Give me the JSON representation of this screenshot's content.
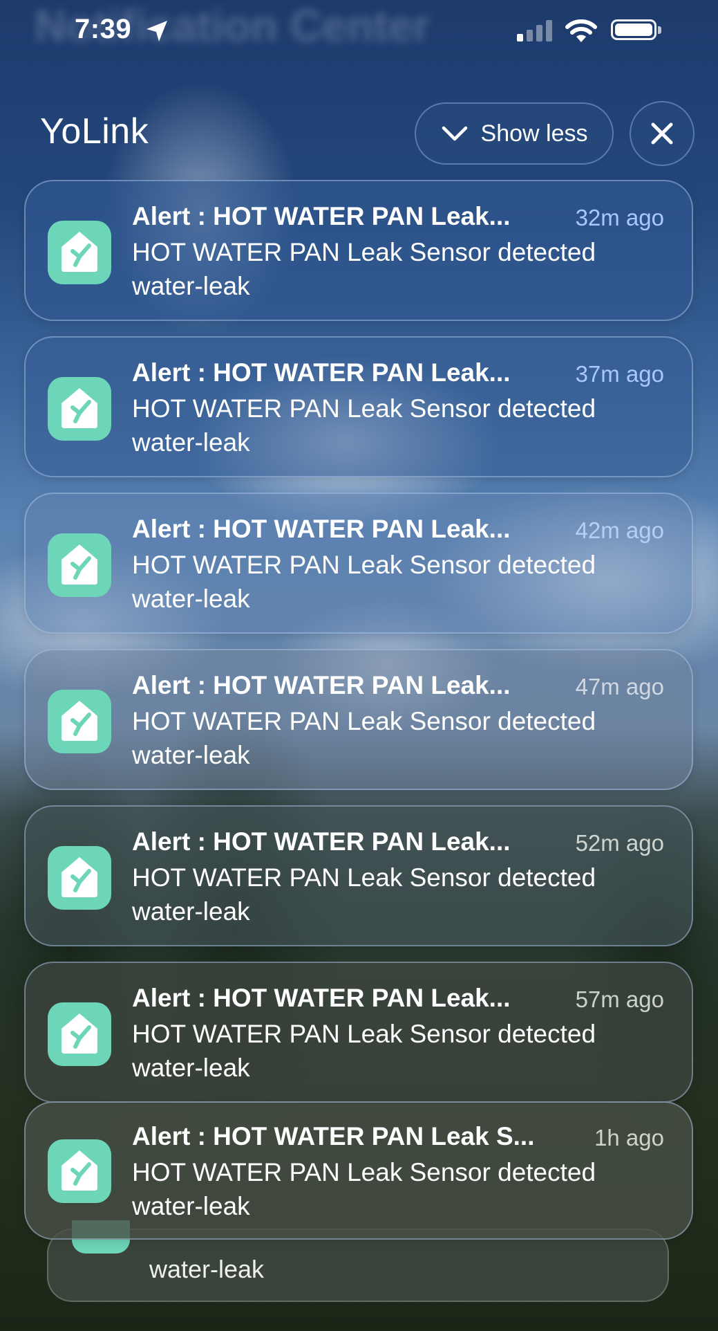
{
  "status_bar": {
    "background_title": "Notification Center",
    "time": "7:39",
    "icons": [
      "location-arrow-icon",
      "cellular-signal-icon",
      "wifi-icon",
      "battery-icon"
    ]
  },
  "header": {
    "app_name": "YoLink",
    "show_less_label": "Show less",
    "show_less_icon": "chevron-down-icon",
    "close_icon": "close-icon"
  },
  "app_icon": {
    "name": "yolink-app-icon",
    "color": "#6dd6b9"
  },
  "notifications": [
    {
      "title": "Alert : HOT WATER PAN Leak...",
      "time": "32m ago",
      "body": "HOT WATER PAN Leak Sensor detected water-leak",
      "time_color": "#a9c8ff"
    },
    {
      "title": "Alert : HOT WATER PAN Leak...",
      "time": "37m ago",
      "body": "HOT WATER PAN Leak Sensor detected water-leak",
      "time_color": "#a9c8ff"
    },
    {
      "title": "Alert : HOT WATER PAN Leak...",
      "time": "42m ago",
      "body": "HOT WATER PAN Leak Sensor detected water-leak",
      "time_color": "#b7cff5"
    },
    {
      "title": "Alert : HOT WATER PAN Leak...",
      "time": "47m ago",
      "body": "HOT WATER PAN Leak Sensor detected water-leak",
      "time_color": "#d0d8e4"
    },
    {
      "title": "Alert : HOT WATER PAN Leak...",
      "time": "52m ago",
      "body": "HOT WATER PAN Leak Sensor detected water-leak",
      "time_color": "#cfd6cf"
    },
    {
      "title": "Alert : HOT WATER PAN Leak...",
      "time": "57m ago",
      "body": "HOT WATER PAN Leak Sensor detected water-leak",
      "time_color": "#cdd3c8"
    },
    {
      "title": "Alert : HOT WATER PAN Leak S...",
      "time": "1h ago",
      "body": "HOT WATER PAN Leak Sensor detected water-leak",
      "time_color": "#cfd3cb"
    }
  ],
  "stacked_notification": {
    "body": "water-leak"
  }
}
